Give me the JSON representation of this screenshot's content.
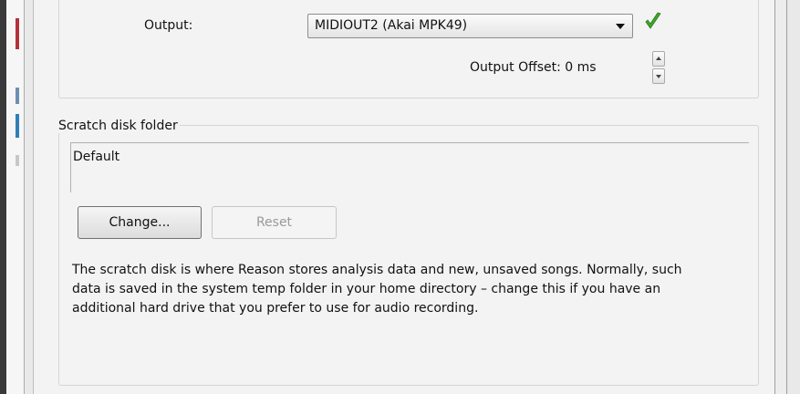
{
  "output": {
    "label": "Output:",
    "selected_device": "MIDIOUT2 (Akai MPK49)",
    "status_icon": "green-checkmark",
    "offset_label": "Output Offset: 0 ms"
  },
  "scratch": {
    "group_title": "Scratch disk folder",
    "path_value": "Default",
    "change_button": "Change...",
    "reset_button": "Reset",
    "description": "The scratch disk is where Reason stores analysis data and new, unsaved songs. Normally, such data is saved in the system temp folder in your home directory – change this if you have an additional hard drive that you prefer to use for audio recording."
  },
  "colors": {
    "check_green": "#3fa52c",
    "panel_bg": "#f3f3f3"
  }
}
